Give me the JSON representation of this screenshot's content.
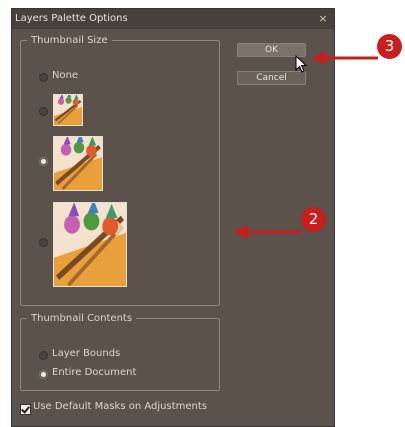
{
  "dialog": {
    "title": "Layers Palette Options",
    "close_glyph": "×"
  },
  "thumbnail_size": {
    "legend": "Thumbnail Size",
    "options": [
      {
        "label": "None",
        "checked": false
      },
      {
        "label": "",
        "checked": false,
        "thumbnail": "small"
      },
      {
        "label": "",
        "checked": false,
        "thumbnail": "medium"
      },
      {
        "label": "",
        "checked": false,
        "thumbnail": "large"
      }
    ]
  },
  "thumbnail_contents": {
    "legend": "Thumbnail Contents",
    "options": [
      {
        "label": "Layer Bounds",
        "checked": false
      },
      {
        "label": "Entire Document",
        "checked": true
      }
    ]
  },
  "buttons": {
    "ok": "OK",
    "cancel": "Cancel"
  },
  "checkbox": {
    "label": "Use Default Masks on Adjustments",
    "checked": true
  },
  "callouts": {
    "two": "2",
    "three": "3"
  },
  "colors": {
    "dialog_bg": "#5a524b",
    "callout_red": "#c81e1e"
  }
}
